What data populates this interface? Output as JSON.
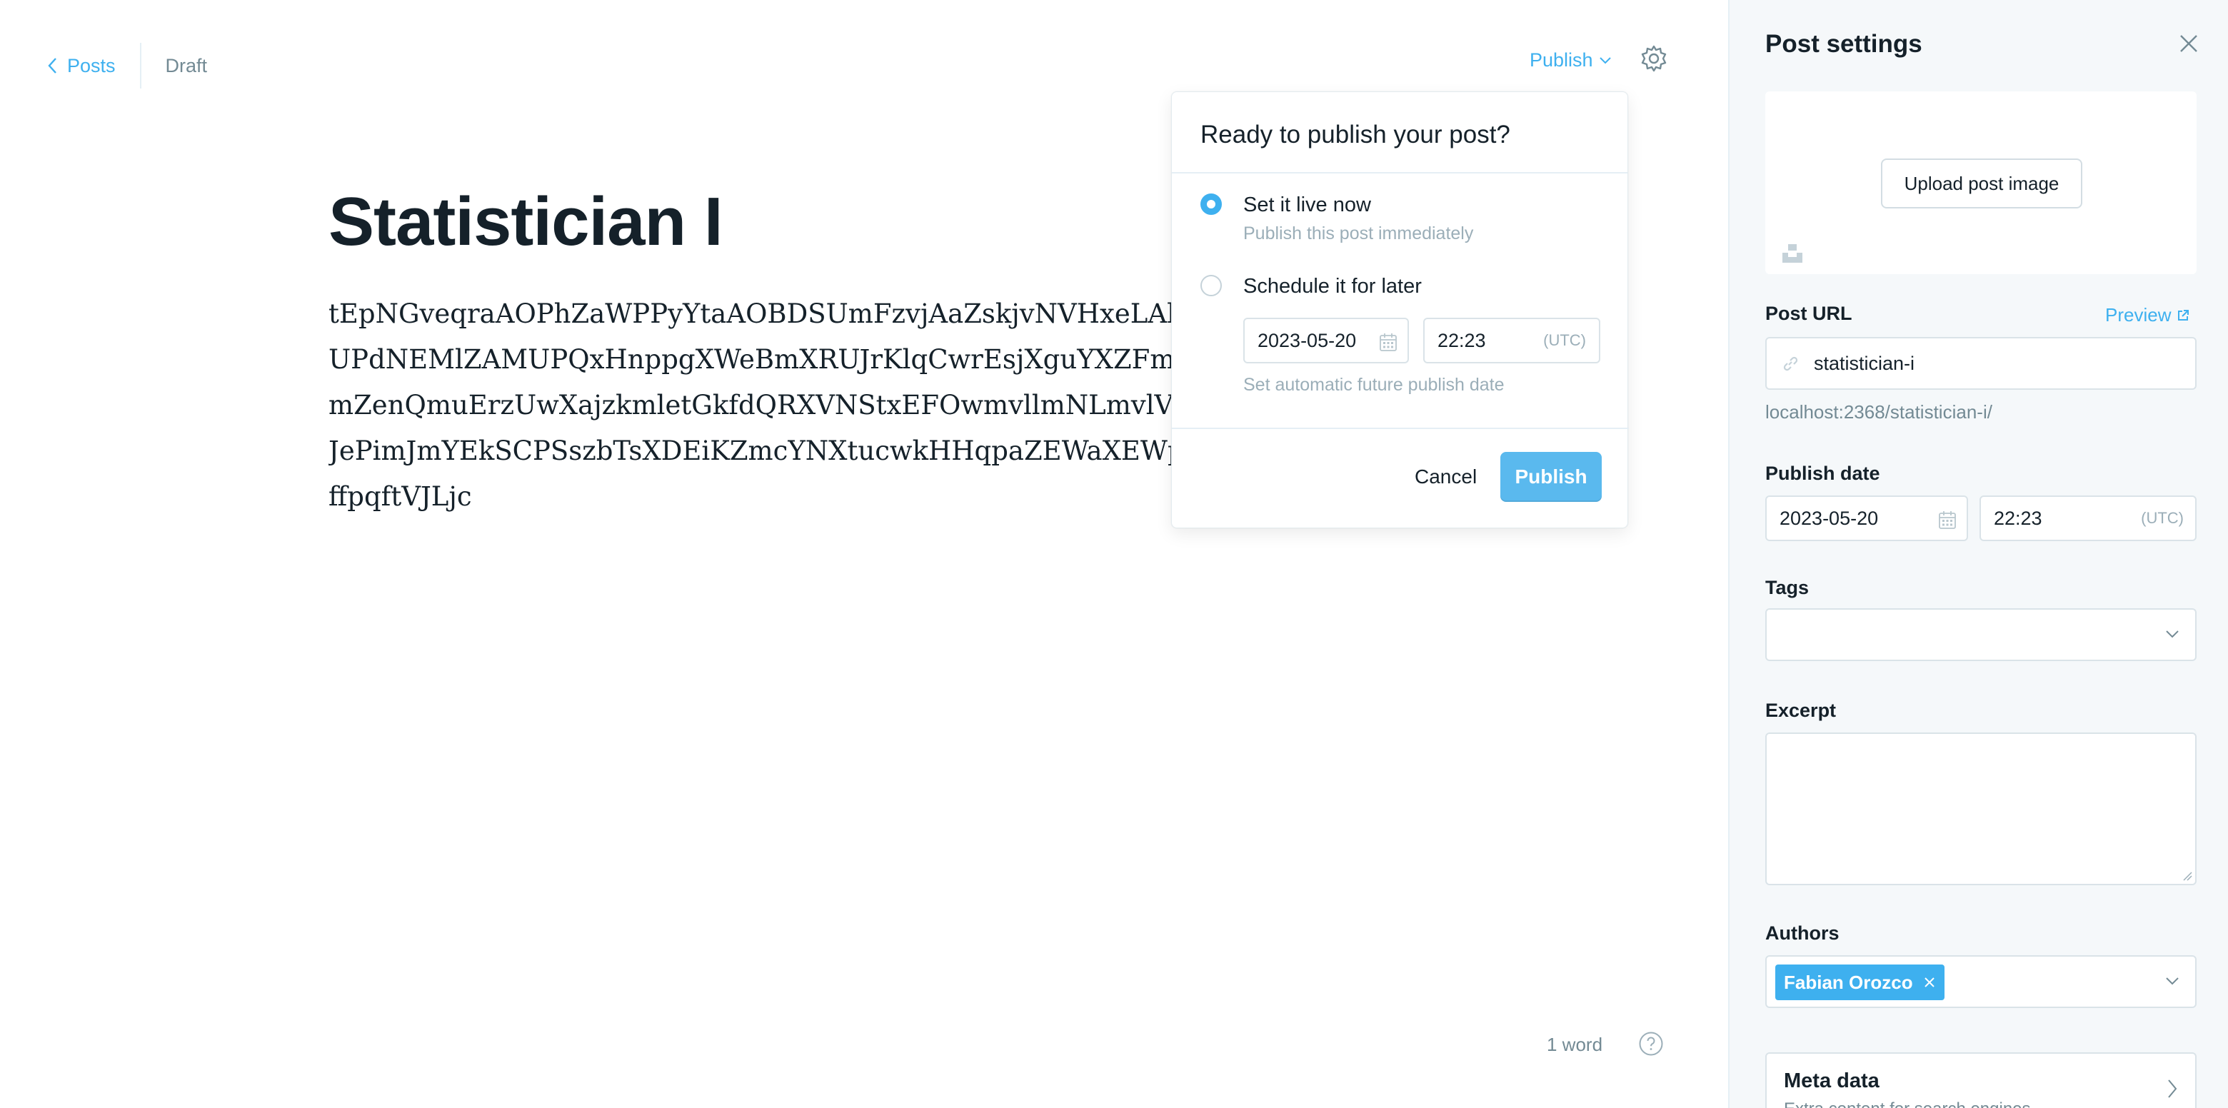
{
  "header": {
    "back_label": "Posts",
    "status": "Draft",
    "publish_menu_label": "Publish"
  },
  "post": {
    "title": "Statistician I",
    "body_lines": [
      "tEpNGveqraAOPhZaWPPyYtaAOBDSUmFzvjAaZskjvNVHxeLAkq",
      "UPdNEMlZAMUPQxHnppgXWeBmXRUJrKlqCwrEsjXguYXZFm",
      "mZenQmuErzUwXajzkmletGkfdQRXVNStxEFOwmvllmNLmvlVF",
      "JePimJmYEkSCPSszbTsXDEiKZmcYNXtucwkHHqpaZEWaXEWp",
      "ffpqftVJLjc"
    ],
    "word_count": "1 word"
  },
  "publish_menu": {
    "heading": "Ready to publish your post?",
    "option_now_title": "Set it live now",
    "option_now_sub": "Publish this post immediately",
    "option_later_title": "Schedule it for later",
    "date": "2023-05-20",
    "time": "22:23",
    "tz": "(UTC)",
    "schedule_hint": "Set automatic future publish date",
    "cancel_label": "Cancel",
    "publish_label": "Publish",
    "selected_option": "now"
  },
  "settings": {
    "title": "Post settings",
    "upload_image_label": "Upload post image",
    "post_url_label": "Post URL",
    "preview_label": "Preview",
    "slug": "statistician-i",
    "full_url": "localhost:2368/statistician-i/",
    "publish_date_label": "Publish date",
    "publish_date": "2023-05-20",
    "publish_time": "22:23",
    "tz": "(UTC)",
    "tags_label": "Tags",
    "excerpt_label": "Excerpt",
    "excerpt_value": "",
    "authors_label": "Authors",
    "author_name": "Fabian Orozco",
    "meta_title": "Meta data",
    "meta_sub": "Extra content for search engines"
  },
  "colors": {
    "accent": "#3eb0ef",
    "publish_button": "#5ab9ee",
    "text": "#15212a",
    "muted": "#738a94",
    "panel_bg": "#f5f8fa"
  }
}
